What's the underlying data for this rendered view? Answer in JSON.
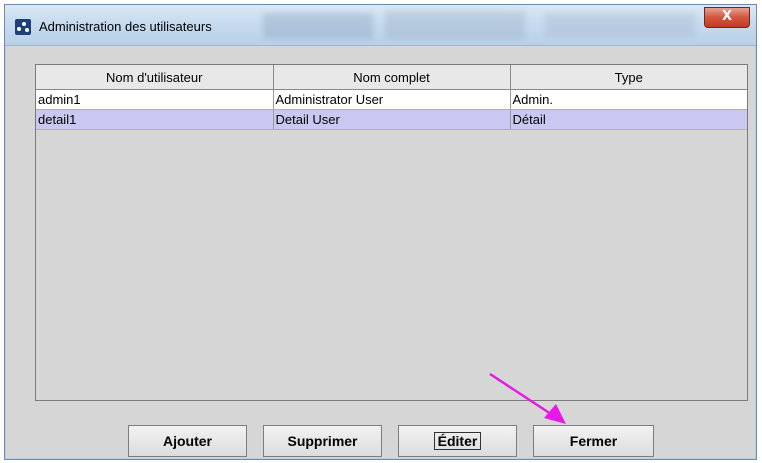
{
  "window": {
    "title": "Administration des utilisateurs",
    "close_label": "X"
  },
  "table": {
    "columns": [
      "Nom d'utilisateur",
      "Nom complet",
      "Type"
    ],
    "rows": [
      [
        "admin1",
        "Administrator User",
        "Admin."
      ],
      [
        "detail1",
        "Detail User",
        "Détail"
      ]
    ],
    "selected_row": 1
  },
  "buttons": {
    "add": "Ajouter",
    "delete": "Supprimer",
    "edit": "Éditer",
    "close": "Fermer"
  },
  "annotation": {
    "arrow_color": "#e619e6"
  },
  "colors": {
    "selection": "#c8c8f2",
    "dialog_bg": "#d6d6d6"
  }
}
